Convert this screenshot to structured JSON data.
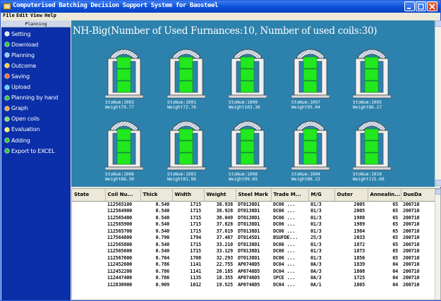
{
  "window": {
    "title": "Computerised Batching Decision Support System for Baosteel"
  },
  "menu": [
    "File",
    "Edit",
    "View",
    "Help"
  ],
  "sidebar": {
    "header": "Planning",
    "items": [
      {
        "label": "Setting",
        "icon": "gear-icon"
      },
      {
        "label": "Download",
        "icon": "download-icon"
      },
      {
        "label": "Planning",
        "icon": "planning-icon"
      },
      {
        "label": "Outcome",
        "icon": "outcome-icon"
      },
      {
        "label": "Saving",
        "icon": "save-icon"
      },
      {
        "label": "Upload",
        "icon": "upload-icon"
      },
      {
        "label": "Planning by hand",
        "icon": "hand-icon"
      },
      {
        "label": "Graph",
        "icon": "graph-icon"
      },
      {
        "label": "Open coils",
        "icon": "open-icon"
      },
      {
        "label": "Evaluation",
        "icon": "evaluation-icon"
      },
      {
        "label": "Adding",
        "icon": "add-icon"
      },
      {
        "label": "Export to EXCEL",
        "icon": "excel-icon"
      }
    ]
  },
  "canvas": {
    "title": "NH-Big(Number of Used Furnances:10, Number of used coils:30)",
    "colors": {
      "background": "#2d82ad",
      "coil": "#22e81e",
      "wall": "#f0f0f0"
    },
    "furnaces": [
      {
        "sto": "StoNum:1002",
        "weight": "Weight79.77",
        "coils": 3
      },
      {
        "sto": "StoNum:1001",
        "weight": "Weight72.76",
        "coils": 3
      },
      {
        "sto": "StoNum:1009",
        "weight": "Weight103.36",
        "coils": 3
      },
      {
        "sto": "StoNum:1007",
        "weight": "Weight95.04",
        "coils": 3
      },
      {
        "sto": "StoNum:1005",
        "weight": "Weight86.27",
        "coils": 3
      },
      {
        "sto": "StoNum:1006",
        "weight": "Weight86.30",
        "coils": 3
      },
      {
        "sto": "StoNum:1003",
        "weight": "Weight81.96",
        "coils": 3
      },
      {
        "sto": "StoNum:1008",
        "weight": "Weight99.65",
        "coils": 3
      },
      {
        "sto": "StoNum:1004",
        "weight": "Weight86.22",
        "coils": 3
      },
      {
        "sto": "StoNum:1010",
        "weight": "Weight115.60",
        "coils": 3
      }
    ]
  },
  "table": {
    "columns": [
      "State",
      "Coil Nu...",
      "Thick",
      "Width",
      "Weight",
      "Steel Mark",
      "Trade M...",
      "M/G",
      "Outer",
      "Annealin...",
      "DueDa"
    ],
    "rows": [
      [
        "",
        "112565100",
        "0.540",
        "1715",
        "38.938",
        "DT0138D1",
        "DC06 ...",
        "01/3",
        "2005",
        "65",
        "200710"
      ],
      [
        "",
        "112564900",
        "0.540",
        "1715",
        "38.928",
        "DT0138D1",
        "DC06 ...",
        "01/3",
        "2005",
        "65",
        "200710"
      ],
      [
        "",
        "112565400",
        "0.540",
        "1715",
        "38.049",
        "DT0138D1",
        "DC06 ...",
        "01/3",
        "1988",
        "65",
        "200710"
      ],
      [
        "",
        "112565900",
        "0.540",
        "1715",
        "37.828",
        "DT0138D1",
        "DC06 ...",
        "01/3",
        "1989",
        "65",
        "200710"
      ],
      [
        "",
        "112565700",
        "0.540",
        "1715",
        "37.619",
        "DT0138D1",
        "DC06 ...",
        "01/3",
        "1984",
        "65",
        "200710"
      ],
      [
        "",
        "117564800",
        "0.790",
        "1794",
        "37.467",
        "DT0145D1",
        "BSUFDE...",
        "25/3",
        "2033",
        "65",
        "200710"
      ],
      [
        "",
        "112565800",
        "0.540",
        "1715",
        "33.210",
        "DT0138D1",
        "DC06 ...",
        "01/3",
        "1872",
        "65",
        "200710"
      ],
      [
        "",
        "112565600",
        "0.540",
        "1715",
        "33.129",
        "DT0138D1",
        "DC06 ...",
        "01/3",
        "1873",
        "65",
        "200710"
      ],
      [
        "",
        "112567600",
        "0.704",
        "1708",
        "32.293",
        "DT0138D1",
        "DC06 ...",
        "01/3",
        "1856",
        "65",
        "200710"
      ],
      [
        "",
        "112452600",
        "0.786",
        "1141",
        "22.755",
        "AP0740D5",
        "DC04 ...",
        "0A/3",
        "1839",
        "04",
        "200710"
      ],
      [
        "",
        "112452200",
        "0.786",
        "1141",
        "20.185",
        "AP0740D5",
        "DC04 ...",
        "0A/3",
        "1808",
        "04",
        "200710"
      ],
      [
        "",
        "112447400",
        "0.786",
        "1135",
        "18.355",
        "AP0740D5",
        "SPCE ...",
        "0A/3",
        "1725",
        "04",
        "200710"
      ],
      [
        "",
        "112830900",
        "0.909",
        "1012",
        "19.525",
        "AP0740D5",
        "DC04 ...",
        "0A/1",
        "1865",
        "04",
        "200710"
      ]
    ]
  }
}
